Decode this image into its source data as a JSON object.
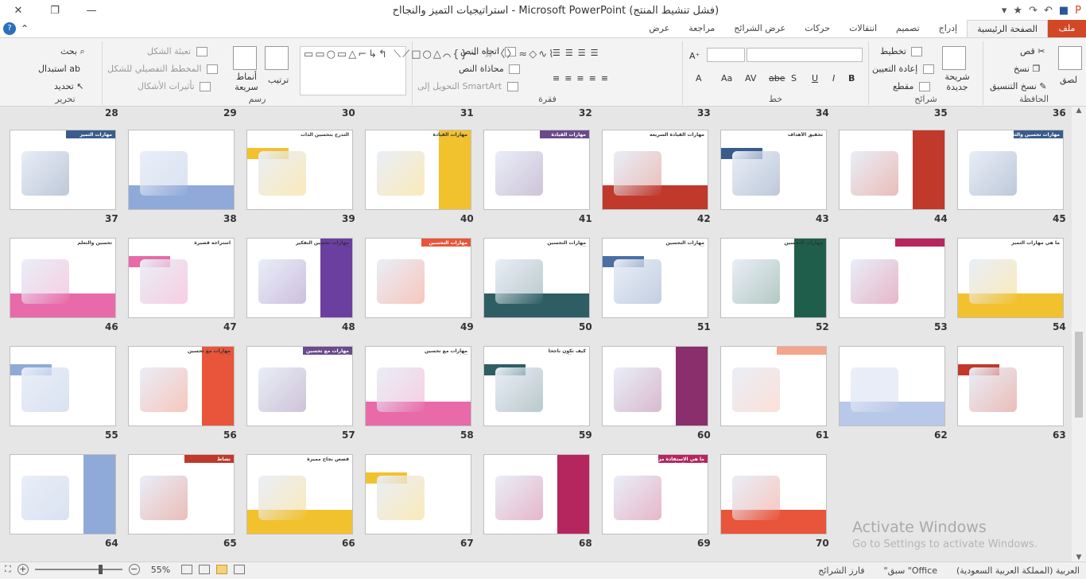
{
  "window": {
    "title": "استراتيجيات التميز والنجااح - Microsoft PowerPoint (فشل تنشيط المنتج)",
    "close": "✕",
    "restore": "❐",
    "minimize": "—"
  },
  "tabs": [
    {
      "label": "ملف",
      "kind": "file"
    },
    {
      "label": "الصفحة الرئيسية",
      "kind": "active"
    },
    {
      "label": "إدراج"
    },
    {
      "label": "تصميم"
    },
    {
      "label": "انتقالات"
    },
    {
      "label": "حركات"
    },
    {
      "label": "عرض الشرائح"
    },
    {
      "label": "مراجعة"
    },
    {
      "label": "عرض"
    }
  ],
  "ribbon": {
    "clipboard": {
      "label": "الحافظة",
      "paste": "لصق",
      "cut": "قص",
      "copy": "نسخ",
      "format_painter": "نسخ التنسيق"
    },
    "slides": {
      "label": "شرائح",
      "new_slide": "شريحة جديدة",
      "layout": "تخطيط",
      "reset": "إعادة التعيين",
      "section": "مقطع"
    },
    "font": {
      "label": "خط",
      "bold": "B",
      "italic": "I",
      "underline": "U",
      "strike": "abe",
      "shadow": "S"
    },
    "paragraph": {
      "label": "فقرة",
      "text_direction": "اتجاه النص",
      "align_text": "محاذاة النص",
      "smartart": "التحويل إلى SmartArt"
    },
    "drawing": {
      "label": "رسم",
      "arrange": "ترتيب",
      "quick_styles": "أنماط سريعة",
      "fill": "تعبئة الشكل",
      "outline": "المخطط التفصيلي للشكل",
      "effects": "تأثيرات الأشكال"
    },
    "editing": {
      "label": "تحرير",
      "find": "بحث",
      "replace": "استبدال",
      "select": "تحديد"
    }
  },
  "slides": [
    {
      "n": 28,
      "kind": "label"
    },
    {
      "n": 29,
      "kind": "label"
    },
    {
      "n": 30,
      "kind": "label"
    },
    {
      "n": 31,
      "kind": "label"
    },
    {
      "n": 32,
      "kind": "label"
    },
    {
      "n": 33,
      "kind": "label"
    },
    {
      "n": 34,
      "kind": "label"
    },
    {
      "n": 35,
      "kind": "label"
    },
    {
      "n": 36,
      "kind": "label"
    }
  ],
  "grid": [
    [
      {
        "n": 37,
        "title": "مهارات التميز",
        "accent": "#3a5c8c"
      },
      {
        "n": 38,
        "title": "",
        "accent": "#8fa9d8"
      },
      {
        "n": 39,
        "title": "التدرج بتحسين الذات",
        "accent": "#f2c12e"
      },
      {
        "n": 40,
        "title": "مهارات القيادة",
        "accent": "#f2c12e"
      },
      {
        "n": 41,
        "title": "مهارات القيادة",
        "accent": "#6b4a8c"
      },
      {
        "n": 42,
        "title": "مهارات القيادة السريعة",
        "accent": "#c0392b"
      },
      {
        "n": 43,
        "title": "تحقيق الأهداف",
        "accent": "#3a5c8c"
      },
      {
        "n": 44,
        "title": "",
        "accent": "#c0392b"
      },
      {
        "n": 45,
        "title": "مهارات تحسين والثقة",
        "accent": "#3a5c8c"
      }
    ],
    [
      {
        "n": 46,
        "title": "تحسين والتعلم",
        "accent": "#e86aa8"
      },
      {
        "n": 47,
        "title": "استراحة قصيرة",
        "accent": "#e86aa8"
      },
      {
        "n": 48,
        "title": "مهارات تحسين التفكير الإبداعي",
        "accent": "#6b3fa0"
      },
      {
        "n": 49,
        "title": "مهارات التحسين المستمر",
        "accent": "#e8553a"
      },
      {
        "n": 50,
        "title": "مهارات التحسين المستمر",
        "accent": "#2e5e63"
      },
      {
        "n": 51,
        "title": "مهارات التحسين المستمر",
        "accent": "#4a6fa5"
      },
      {
        "n": 52,
        "title": "مهارات التحسين المستمر",
        "accent": "#1e5e4a"
      },
      {
        "n": 53,
        "title": "",
        "accent": "#b5265f"
      },
      {
        "n": 54,
        "title": "ما هي مهارات التميز",
        "accent": "#f2c12e"
      }
    ],
    [
      {
        "n": 55,
        "title": "",
        "accent": "#8fa9d8"
      },
      {
        "n": 56,
        "title": "مهارات مع تحسين الذات",
        "accent": "#e8553a"
      },
      {
        "n": 57,
        "title": "مهارات مع تحسين الذات",
        "accent": "#6b4a8c"
      },
      {
        "n": 58,
        "title": "مهارات مع تحسين الذات",
        "accent": "#e86aa8"
      },
      {
        "n": 59,
        "title": "كيف تكون ناجحا ونشيطا",
        "accent": "#2e5e63"
      },
      {
        "n": 60,
        "title": "",
        "accent": "#8a2f6b"
      },
      {
        "n": 61,
        "title": "",
        "accent": "#f4a58a"
      },
      {
        "n": 62,
        "title": "",
        "accent": "#b8c8e8"
      },
      {
        "n": 63,
        "title": "",
        "accent": "#c0392b"
      }
    ],
    [
      {
        "n": 64,
        "title": "",
        "accent": "#8fa9d8"
      },
      {
        "n": 65,
        "title": "نشاط",
        "accent": "#c0392b"
      },
      {
        "n": 66,
        "title": "قصص نجاح مميزة",
        "accent": "#f2c12e"
      },
      {
        "n": 67,
        "title": "",
        "accent": "#f2c12e"
      },
      {
        "n": 68,
        "title": "",
        "accent": "#b5265f"
      },
      {
        "n": 69,
        "title": "ما هي الاستفادة من القصص السابقة",
        "accent": "#b5265f"
      },
      {
        "n": 70,
        "title": "",
        "accent": "#e8553a"
      }
    ]
  ],
  "watermark": {
    "line1": "Activate Windows",
    "line2": "Go to Settings to activate Windows."
  },
  "status": {
    "slides_pane": "فارز الشرائح",
    "theme": "\"سبق \"Office",
    "language": "العربية (المملكة العربية السعودية)",
    "zoom": "55%"
  }
}
